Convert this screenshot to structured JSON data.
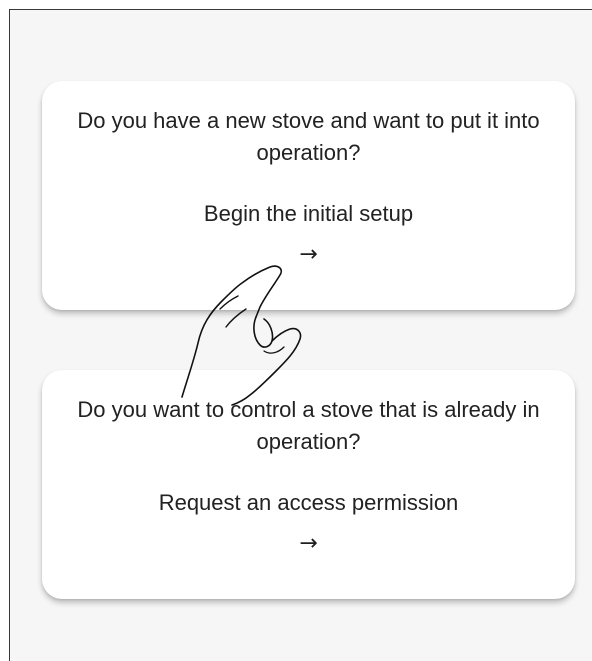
{
  "cards": [
    {
      "question": "Do you have a new stove and want to put it into operation?",
      "action": "Begin the initial setup",
      "arrow": "→"
    },
    {
      "question": "Do you want to control a stove that is already in operation?",
      "action": "Request an access permission",
      "arrow": "→"
    }
  ],
  "overlay": {
    "icon": "hand-pointer-icon"
  }
}
